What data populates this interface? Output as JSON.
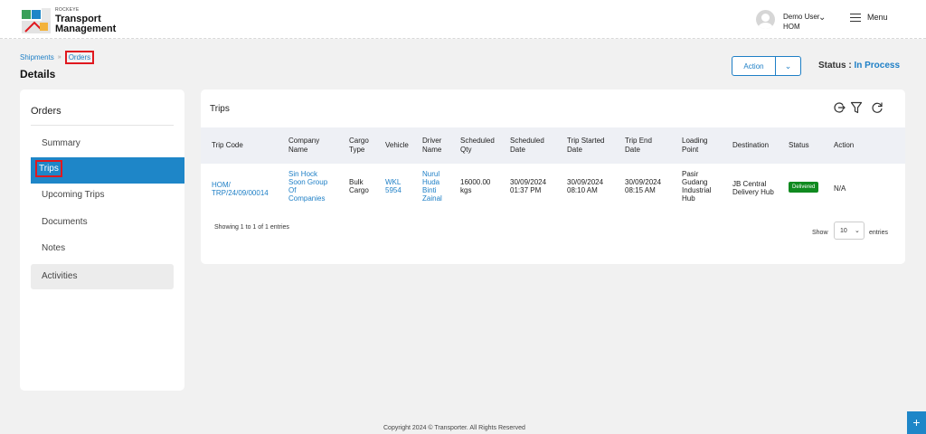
{
  "header": {
    "brand_small": "ROCKEYE",
    "brand_line1": "Transport",
    "brand_line2": "Management",
    "user_name": "Demo User",
    "user_org": "HOM",
    "menu_label": "Menu"
  },
  "breadcrumb": {
    "parent": "Shipments",
    "separator": "»",
    "current": "Orders"
  },
  "page": {
    "title": "Details",
    "action_label": "Action",
    "status_label": "Status :",
    "status_value": "In Process"
  },
  "sidebar": {
    "heading": "Orders",
    "items": [
      {
        "label": "Summary"
      },
      {
        "label": "Trips",
        "selected": true
      },
      {
        "label": "Upcoming Trips"
      },
      {
        "label": "Documents"
      },
      {
        "label": "Notes"
      },
      {
        "label": "Activities"
      }
    ]
  },
  "trips": {
    "title": "Trips",
    "tools": [
      "export-icon",
      "filter-icon",
      "refresh-icon"
    ],
    "columns": [
      {
        "l1": "Trip Code",
        "l2": ""
      },
      {
        "l1": "Company",
        "l2": "Name"
      },
      {
        "l1": "Cargo",
        "l2": "Type"
      },
      {
        "l1": "Vehicle",
        "l2": ""
      },
      {
        "l1": "Driver",
        "l2": "Name"
      },
      {
        "l1": "Scheduled",
        "l2": "Qty"
      },
      {
        "l1": "Scheduled",
        "l2": "Date"
      },
      {
        "l1": "Trip Started",
        "l2": "Date"
      },
      {
        "l1": "Trip End",
        "l2": "Date"
      },
      {
        "l1": "Loading",
        "l2": "Point"
      },
      {
        "l1": "Destination",
        "l2": ""
      },
      {
        "l1": "Status",
        "l2": ""
      },
      {
        "l1": "Action",
        "l2": ""
      }
    ],
    "row": {
      "trip_code": [
        "HOM/",
        "TRP/24/09/00014"
      ],
      "company": [
        "Sin Hock",
        "Soon Group",
        "Of",
        "Companies"
      ],
      "cargo": [
        "Bulk",
        "Cargo"
      ],
      "vehicle": [
        "WKL",
        "5954"
      ],
      "driver": [
        "Nurul",
        "Huda",
        "Binti",
        "Zainal"
      ],
      "qty": [
        "16000.00",
        "kgs"
      ],
      "scheduled_date": [
        "30/09/2024",
        "01:37 PM"
      ],
      "started_date": [
        "30/09/2024",
        "08:10 AM"
      ],
      "end_date": [
        "30/09/2024",
        "08:15 AM"
      ],
      "loading_point": [
        "Pasir",
        "Gudang",
        "Industrial",
        "Hub"
      ],
      "destination": [
        "JB Central",
        "Delivery Hub"
      ],
      "status": "Delivered",
      "action": "N/A"
    },
    "showing": "Showing 1 to 1 of 1 entries",
    "show_label": "Show",
    "page_size": "10",
    "entries_label": "entries"
  },
  "footer": {
    "copyright": "Copyright 2024 © Transporter. All Rights Reserved"
  },
  "fab_label": "+"
}
